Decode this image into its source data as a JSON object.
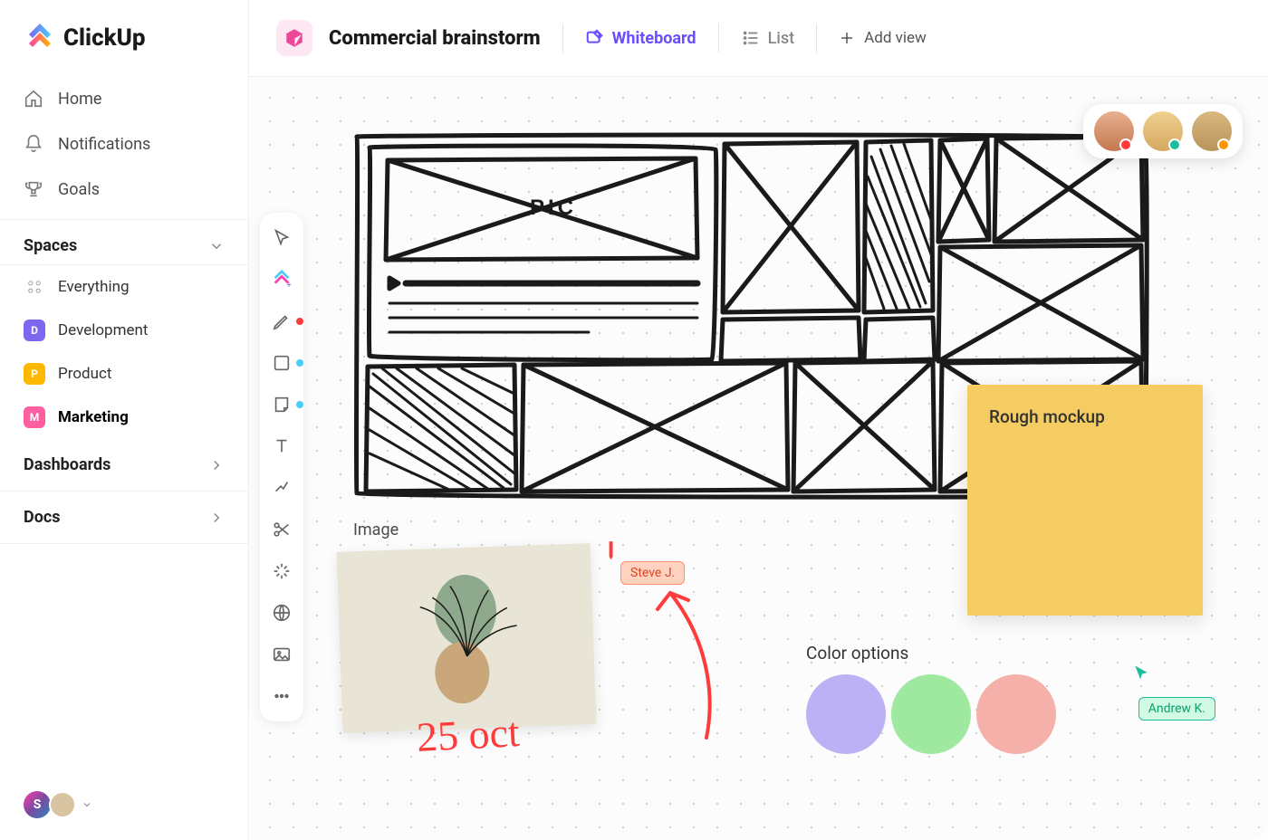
{
  "app": {
    "name": "ClickUp"
  },
  "nav": {
    "home": "Home",
    "notifications": "Notifications",
    "goals": "Goals"
  },
  "sidebar": {
    "spaces_header": "Spaces",
    "everything": "Everything",
    "items": [
      {
        "letter": "D",
        "label": "Development"
      },
      {
        "letter": "P",
        "label": "Product"
      },
      {
        "letter": "M",
        "label": "Marketing"
      }
    ],
    "dashboards": "Dashboards",
    "docs": "Docs",
    "user_initial": "S"
  },
  "workspace": {
    "title": "Commercial brainstorm",
    "views": {
      "whiteboard": "Whiteboard",
      "list": "List",
      "add": "Add view"
    }
  },
  "canvas": {
    "sketch_pic_label": "PIC",
    "sticky_note": "Rough mockup",
    "image_label": "Image",
    "date_annotation": "25 oct",
    "color_options_title": "Color options",
    "color_options": [
      "#BDB1F5",
      "#9FE89F",
      "#F5B1A9"
    ],
    "cursor_user_1": "Steve J.",
    "cursor_user_2": "Andrew K."
  },
  "tools": [
    "pointer",
    "clickup",
    "pen",
    "shape",
    "note",
    "text",
    "connector",
    "scissors",
    "sparkle",
    "web",
    "image",
    "more"
  ],
  "avatars": [
    {
      "name": "user-1",
      "status": "#FF3B3B"
    },
    {
      "name": "user-2",
      "status": "#1ABC9C"
    },
    {
      "name": "user-3",
      "status": "#FF9500"
    }
  ]
}
